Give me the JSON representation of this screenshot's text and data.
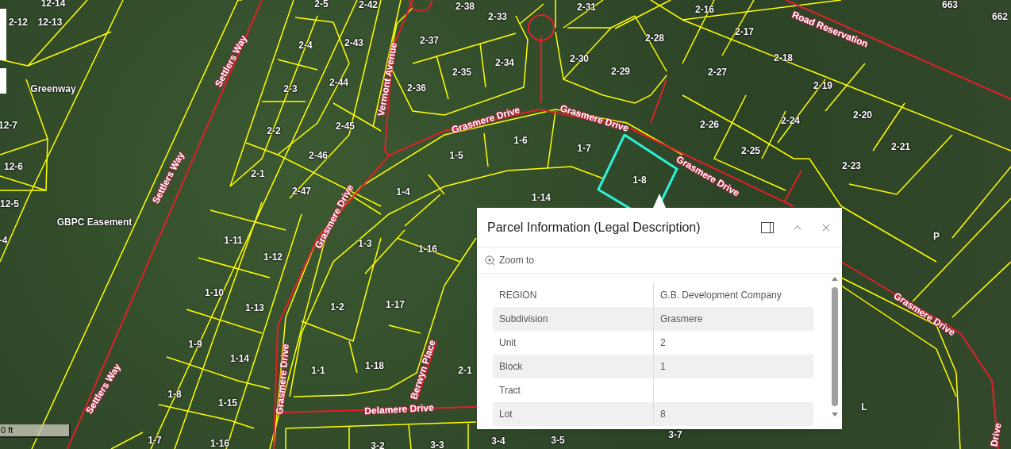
{
  "map": {
    "parcel_labels": [
      {
        "text": "12-14",
        "selected": false
      },
      {
        "text": "2-12",
        "selected": false
      },
      {
        "text": "12-13",
        "selected": false
      },
      {
        "text": "12-7",
        "selected": false
      },
      {
        "text": "12-6",
        "selected": false
      },
      {
        "text": "12-5",
        "selected": false
      },
      {
        "text": "-4",
        "selected": false
      },
      {
        "text": "2-5",
        "selected": false
      },
      {
        "text": "2-42",
        "selected": false
      },
      {
        "text": "2-38",
        "selected": false
      },
      {
        "text": "2-33",
        "selected": false
      },
      {
        "text": "2-31",
        "selected": false
      },
      {
        "text": "2-16",
        "selected": false
      },
      {
        "text": "663",
        "selected": false
      },
      {
        "text": "662",
        "selected": false
      },
      {
        "text": "2-4",
        "selected": false
      },
      {
        "text": "2-43",
        "selected": false
      },
      {
        "text": "2-37",
        "selected": false
      },
      {
        "text": "2-28",
        "selected": false
      },
      {
        "text": "2-17",
        "selected": false
      },
      {
        "text": "2-18",
        "selected": false
      },
      {
        "text": "2-3",
        "selected": false
      },
      {
        "text": "2-44",
        "selected": false
      },
      {
        "text": "2-36",
        "selected": false
      },
      {
        "text": "2-35",
        "selected": false
      },
      {
        "text": "2-34",
        "selected": false
      },
      {
        "text": "2-30",
        "selected": false
      },
      {
        "text": "2-29",
        "selected": false
      },
      {
        "text": "2-27",
        "selected": false
      },
      {
        "text": "2-19",
        "selected": false
      },
      {
        "text": "2-2",
        "selected": false
      },
      {
        "text": "2-45",
        "selected": false
      },
      {
        "text": "2-26",
        "selected": false
      },
      {
        "text": "2-24",
        "selected": false
      },
      {
        "text": "2-20",
        "selected": false
      },
      {
        "text": "2-46",
        "selected": false
      },
      {
        "text": "1-5",
        "selected": false
      },
      {
        "text": "1-6",
        "selected": false
      },
      {
        "text": "1-7",
        "selected": false
      },
      {
        "text": "1-8",
        "selected": true
      },
      {
        "text": "2-25",
        "selected": false
      },
      {
        "text": "2-23",
        "selected": false
      },
      {
        "text": "2-21",
        "selected": false
      },
      {
        "text": "2-1",
        "selected": false
      },
      {
        "text": "2-47",
        "selected": false
      },
      {
        "text": "1-4",
        "selected": false
      },
      {
        "text": "1-14",
        "selected": false
      },
      {
        "text": "1-11",
        "selected": false
      },
      {
        "text": "1-12",
        "selected": false
      },
      {
        "text": "1-3",
        "selected": false
      },
      {
        "text": "1-16",
        "selected": false
      },
      {
        "text": "P",
        "selected": false
      },
      {
        "text": "1-10",
        "selected": false
      },
      {
        "text": "1-13",
        "selected": false
      },
      {
        "text": "1-2",
        "selected": false
      },
      {
        "text": "1-17",
        "selected": false
      },
      {
        "text": "1-9",
        "selected": false
      },
      {
        "text": "1-14",
        "selected": false
      },
      {
        "text": "1-1",
        "selected": false
      },
      {
        "text": "1-18",
        "selected": false
      },
      {
        "text": "2-1",
        "selected": false
      },
      {
        "text": "1-8",
        "selected": false
      },
      {
        "text": "1-15",
        "selected": false
      },
      {
        "text": "L",
        "selected": false
      },
      {
        "text": "1-7",
        "selected": false
      },
      {
        "text": "1-16",
        "selected": false
      },
      {
        "text": "3-2",
        "selected": false
      },
      {
        "text": "3-3",
        "selected": false
      },
      {
        "text": "3-4",
        "selected": false
      },
      {
        "text": "3-5",
        "selected": false
      },
      {
        "text": "3-7",
        "selected": false
      }
    ],
    "area_labels": [
      "Greenway",
      "GBPC Easement"
    ],
    "road_labels": [
      "Settlers Way",
      "Settlers Way",
      "Settlers Way",
      "Vermont Avenue",
      "Grasmere Drive",
      "Grasmere Drive",
      "Grasmere Drive",
      "Grasmere Drive",
      "Grasmere Drive",
      "Grasmere Drive",
      "Drive",
      "Road Reservation",
      "Berwyn Place",
      "Delamere Drive"
    ],
    "scale_bar": "0 ft"
  },
  "popup": {
    "title": "Parcel Information (Legal Description)",
    "action": "Zoom to",
    "rows": [
      {
        "field": "REGION",
        "value": "G.B. Development Company"
      },
      {
        "field": "Subdivision",
        "value": "Grasmere"
      },
      {
        "field": "Unit",
        "value": "2"
      },
      {
        "field": "Block",
        "value": "1"
      },
      {
        "field": "Tract"
      },
      {
        "field": "Lot",
        "value": "8"
      }
    ]
  }
}
